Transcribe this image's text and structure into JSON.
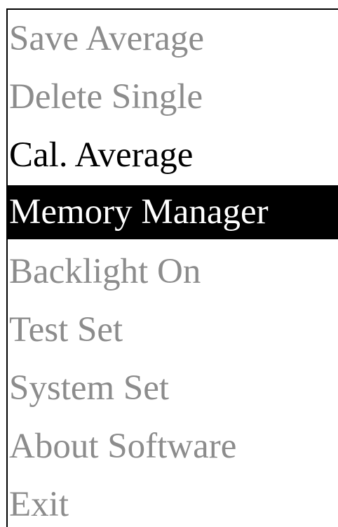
{
  "menu": {
    "items": [
      {
        "label": "Save Average",
        "state": "disabled"
      },
      {
        "label": "Delete Single",
        "state": "disabled"
      },
      {
        "label": "Cal. Average",
        "state": "enabled"
      },
      {
        "label": "Memory Manager",
        "state": "selected"
      },
      {
        "label": "Backlight On",
        "state": "disabled"
      },
      {
        "label": "Test Set",
        "state": "disabled"
      },
      {
        "label": "System Set",
        "state": "disabled"
      },
      {
        "label": "About Software",
        "state": "disabled"
      },
      {
        "label": "Exit",
        "state": "disabled"
      }
    ]
  },
  "colors": {
    "background": "#ffffff",
    "frame": "#000000",
    "text_enabled": "#000000",
    "text_disabled": "#8c8c8c",
    "highlight_background": "#000000",
    "highlight_text": "#ffffff"
  }
}
